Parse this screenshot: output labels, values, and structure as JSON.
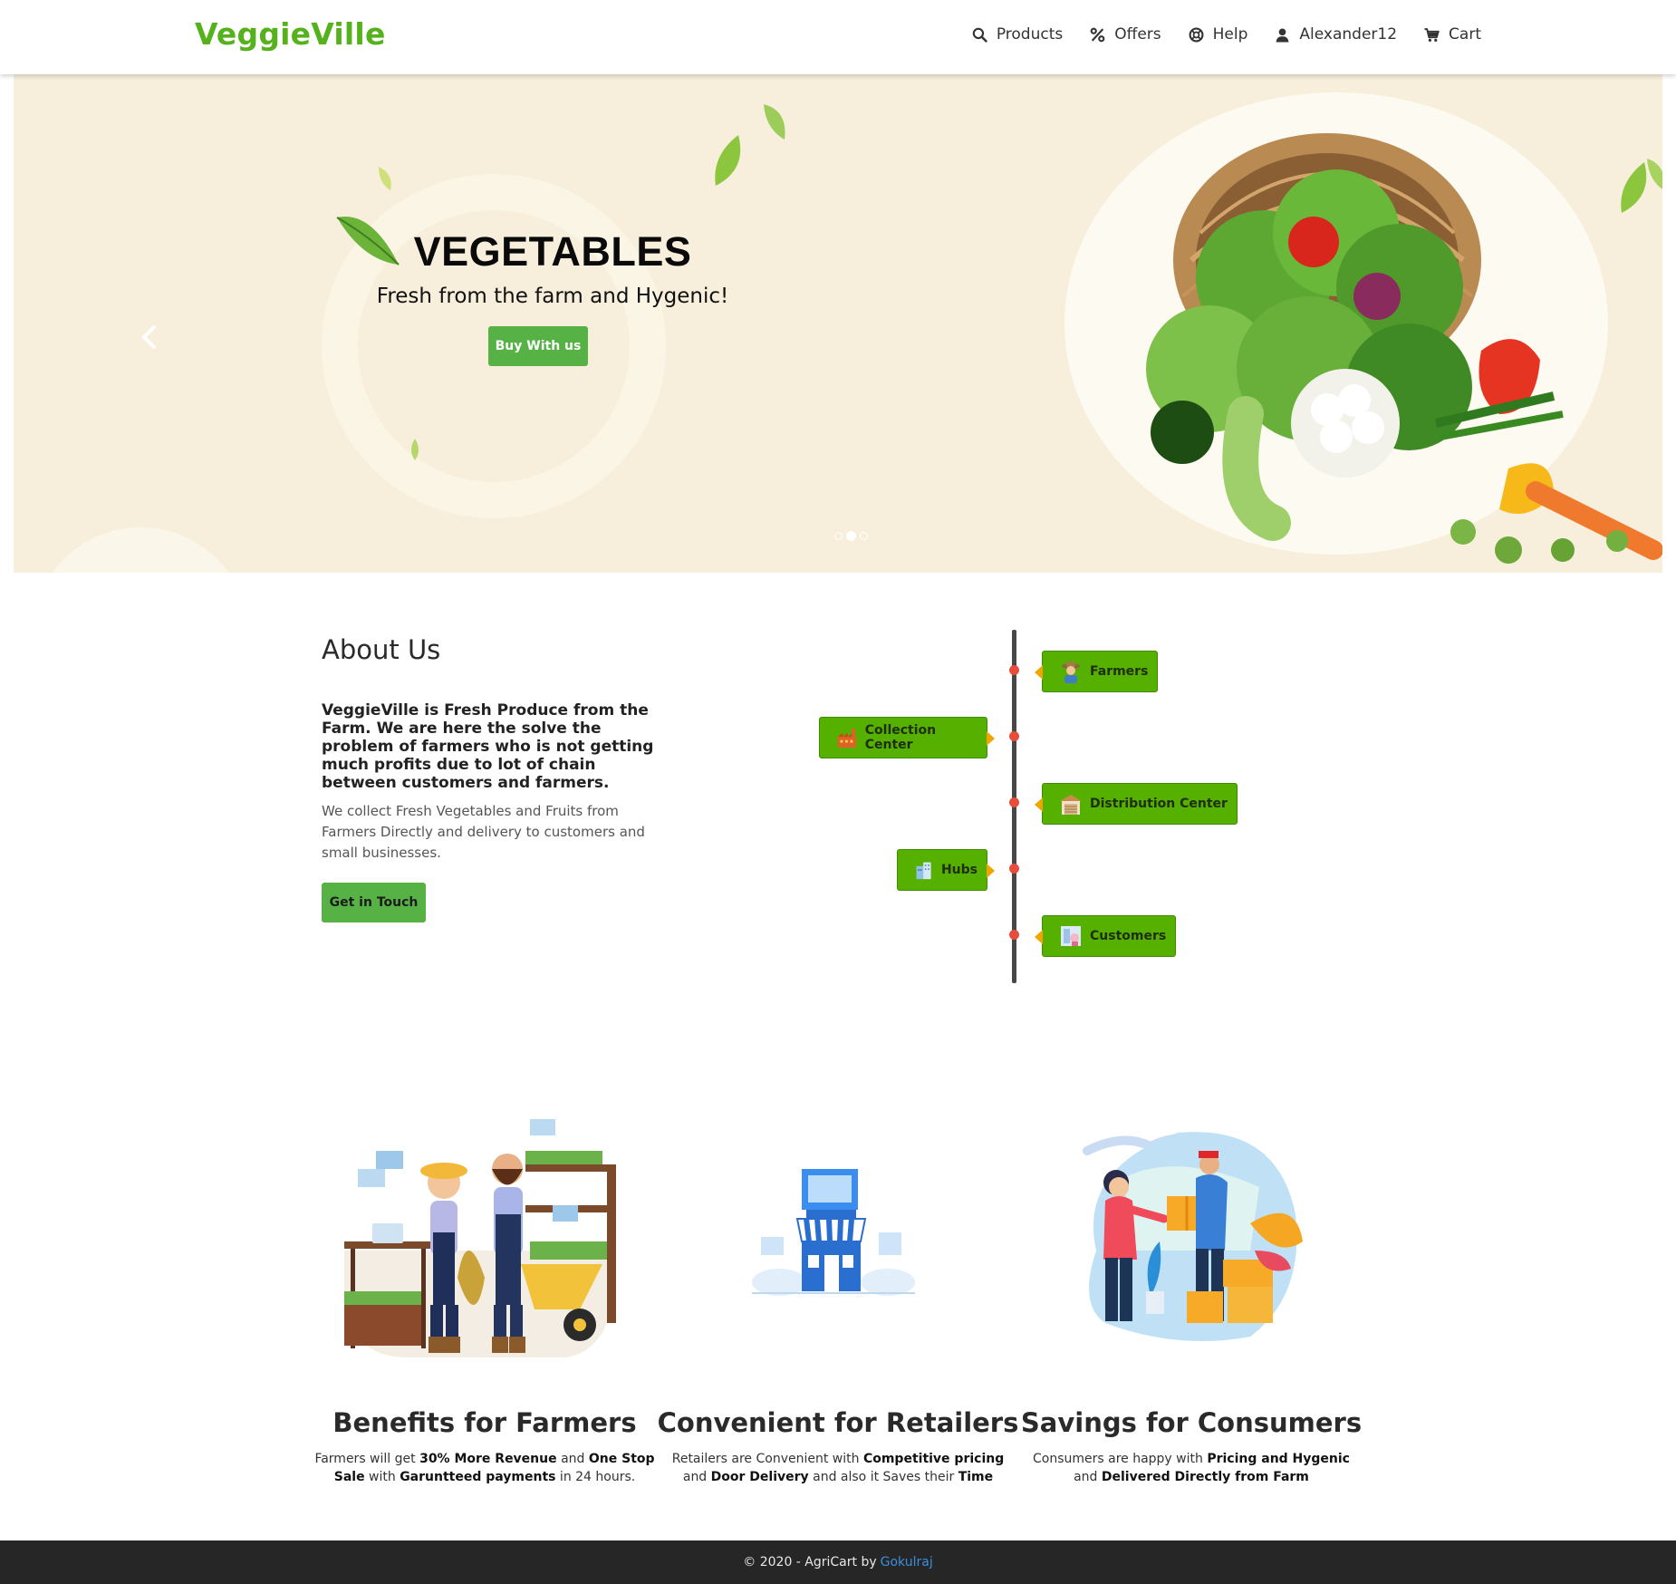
{
  "navbar": {
    "brand": "VeggieVille",
    "items": [
      {
        "label": "Products",
        "icon": "search-icon"
      },
      {
        "label": "Offers",
        "icon": "percent-icon"
      },
      {
        "label": "Help",
        "icon": "lifebuoy-icon"
      },
      {
        "label": "Alexander12",
        "icon": "user-icon"
      },
      {
        "label": "Cart",
        "icon": "cart-icon"
      }
    ]
  },
  "hero": {
    "title": "VEGETABLES",
    "subtitle": "Fresh from the farm and Hygenic!",
    "button": "Buy With us",
    "slide_count": 3,
    "active_slide": 2
  },
  "about": {
    "title": "About Us",
    "lead": "VeggieVille is Fresh Produce from the Farm. We are here the solve the problem of farmers who is not getting much profits due to lot of chain between customers and farmers.",
    "text": "We collect Fresh Vegetables and Fruits from Farmers Directly and delivery to customers and small businesses.",
    "button": "Get in Touch"
  },
  "timeline": {
    "steps": [
      {
        "label": "Farmers",
        "icon": "farmer-icon",
        "side": "right"
      },
      {
        "label": "Collection Center",
        "icon": "factory-icon",
        "side": "left"
      },
      {
        "label": "Distribution Center",
        "icon": "warehouse-icon",
        "side": "right"
      },
      {
        "label": "Hubs",
        "icon": "buildings-icon",
        "side": "left"
      },
      {
        "label": "Customers",
        "icon": "customer-icon",
        "side": "right"
      }
    ]
  },
  "features": [
    {
      "title": "Benefits for Farmers",
      "parts": [
        {
          "t": "Farmers will get ",
          "b": false
        },
        {
          "t": "30% More Revenue",
          "b": true
        },
        {
          "t": " and ",
          "b": false
        },
        {
          "t": "One Stop Sale",
          "b": true
        },
        {
          "t": " with ",
          "b": false
        },
        {
          "t": "Garuntteed payments",
          "b": true
        },
        {
          "t": " in 24 hours.",
          "b": false
        }
      ]
    },
    {
      "title": "Convenient for Retailers",
      "parts": [
        {
          "t": "Retailers are Convenient with ",
          "b": false
        },
        {
          "t": "Competitive pricing",
          "b": true
        },
        {
          "t": " and ",
          "b": false
        },
        {
          "t": "Door Delivery",
          "b": true
        },
        {
          "t": " and also it Saves their ",
          "b": false
        },
        {
          "t": "Time",
          "b": true
        }
      ]
    },
    {
      "title": "Savings for Consumers",
      "parts": [
        {
          "t": "Consumers are happy with ",
          "b": false
        },
        {
          "t": "Pricing and Hygenic",
          "b": true
        },
        {
          "t": " and ",
          "b": false
        },
        {
          "t": "Delivered Directly from Farm",
          "b": true
        }
      ]
    }
  ],
  "footer": {
    "text": "© 2020 - AgriCart by",
    "link": "Gokulraj"
  },
  "colors": {
    "brand": "#55b21c",
    "button": "#57b246",
    "hero_bg": "#f7efdb",
    "timeline_box": "#56b000",
    "timeline_dot": "#e74c3c",
    "footer_bg": "#262626",
    "footer_link": "#3b8ed8"
  }
}
